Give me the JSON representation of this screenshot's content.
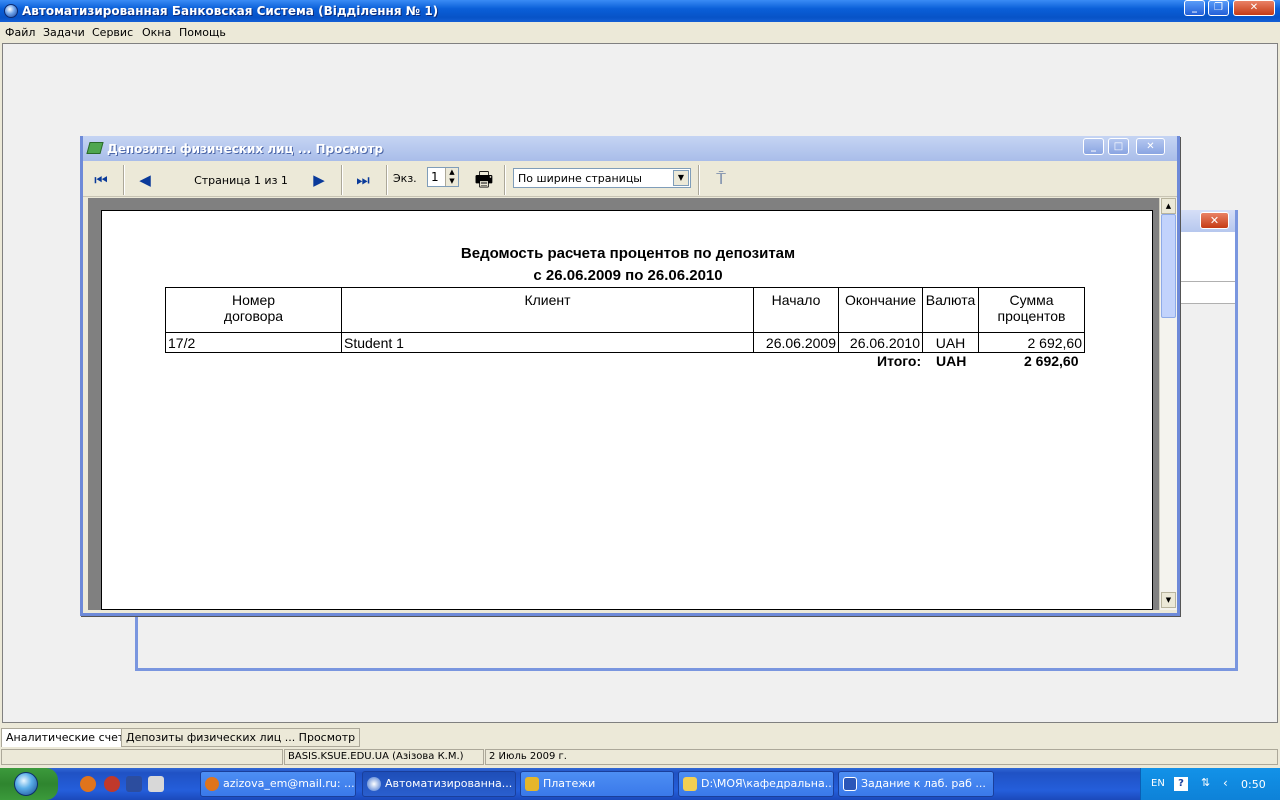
{
  "app": {
    "title": "Автоматизированная Банковская Система (Відділення № 1)"
  },
  "menu": [
    "Файл",
    "Задачи",
    "Сервис",
    "Окна",
    "Помощь"
  ],
  "preview": {
    "title": "Депозиты физических лиц ... Просмотр",
    "toolbar": {
      "page_text": "Страница 1 из 1",
      "copies_label": "Экз.",
      "copies_value": "1",
      "zoom_value": "По ширине страницы"
    }
  },
  "report": {
    "title": "Ведомость расчета процентов по депозитам",
    "period": "с 26.06.2009 по 26.06.2010",
    "headers": {
      "contract_line1": "Номер",
      "contract_line2": "договора",
      "client": "Клиент",
      "start": "Начало",
      "end": "Окончание",
      "currency": "Валюта",
      "sum_line1": "Сумма",
      "sum_line2": "процентов"
    },
    "rows": [
      {
        "contract": "17/2",
        "client": "Student 1",
        "start": "26.06.2009",
        "end": "26.06.2010",
        "currency": "UAH",
        "sum": "2 692,60"
      }
    ],
    "totals": {
      "label": "Итого:",
      "currency": "UAH",
      "sum": "2 692,60"
    }
  },
  "mdi_tabs": [
    "Аналитические счета",
    "Депозиты физических лиц ... Просмотр"
  ],
  "status": {
    "user": "BASIS.KSUE.EDU.UA (Азізова К.М.)",
    "date": "2 Июль 2009 г."
  },
  "taskbar": {
    "tasks": [
      "azizova_em@mail.ru: ...",
      "Автоматизированна...",
      "Платежи",
      "D:\\МОЯ\\кафедральна...",
      "Задание к лаб. раб ..."
    ],
    "lang": "EN",
    "help": "?",
    "clock": "0:50"
  },
  "colors": {
    "title_blue": "#0a5fd8",
    "taskbar_blue": "#245edb",
    "start_green": "#3c9a3c"
  }
}
